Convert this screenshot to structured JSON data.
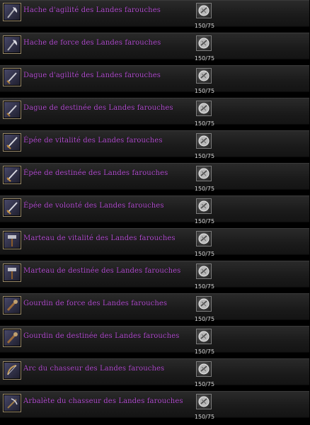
{
  "items": [
    {
      "name": "Hache d'agilité des Landes farouches",
      "icon": "axe-icon",
      "count": "150/75"
    },
    {
      "name": "Hache de force des Landes farouches",
      "icon": "axe-icon",
      "count": "150/75"
    },
    {
      "name": "Dague d'agilité des Landes farouches",
      "icon": "dagger-icon",
      "count": "150/75"
    },
    {
      "name": "Dague de destinée des Landes farouches",
      "icon": "dagger-icon",
      "count": "150/75"
    },
    {
      "name": "Épée de vitalité des Landes farouches",
      "icon": "sword-icon",
      "count": "150/75"
    },
    {
      "name": "Épée de destinée des Landes farouches",
      "icon": "sword-icon",
      "count": "150/75"
    },
    {
      "name": "Épée de volonté des Landes farouches",
      "icon": "sword-icon",
      "count": "150/75"
    },
    {
      "name": "Marteau de vitalité des Landes farouches",
      "icon": "hammer-icon",
      "count": "150/75"
    },
    {
      "name": "Marteau de destinée des Landes farouches",
      "icon": "hammer-icon",
      "count": "150/75"
    },
    {
      "name": "Gourdin de force des Landes farouches",
      "icon": "club-icon",
      "count": "150/75"
    },
    {
      "name": "Gourdin de destinée des Landes farouches",
      "icon": "club-icon",
      "count": "150/75"
    },
    {
      "name": "Arc du chasseur des Landes farouches",
      "icon": "bow-icon",
      "count": "150/75"
    },
    {
      "name": "Arbalète du chasseur des Landes farouches",
      "icon": "crossbow-icon",
      "count": "150/75"
    }
  ],
  "currency_icon": "token-icon",
  "colors": {
    "item_name": "#b24fcf",
    "count": "#d4d4d4"
  }
}
